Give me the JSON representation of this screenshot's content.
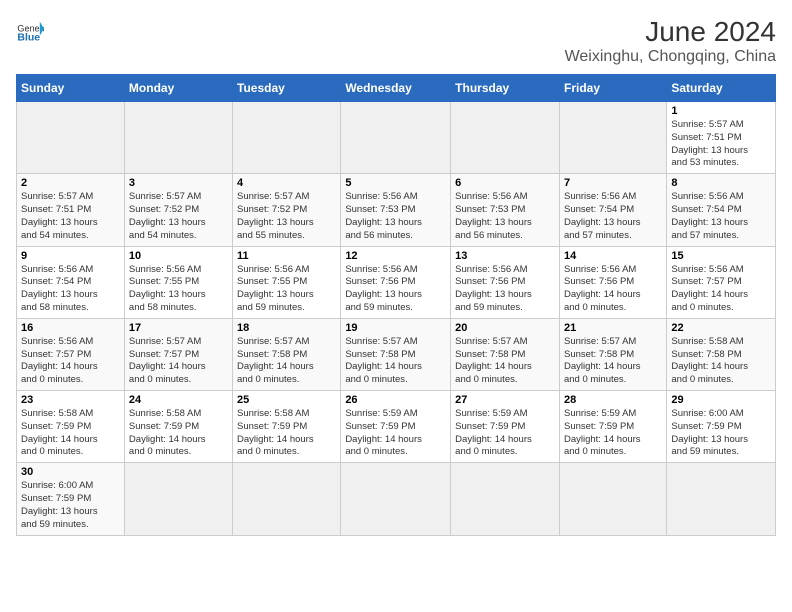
{
  "header": {
    "logo_general": "General",
    "logo_blue": "Blue",
    "main_title": "June 2024",
    "subtitle": "Weixinghu, Chongqing, China"
  },
  "columns": [
    "Sunday",
    "Monday",
    "Tuesday",
    "Wednesday",
    "Thursday",
    "Friday",
    "Saturday"
  ],
  "weeks": [
    [
      {
        "day": "",
        "info": ""
      },
      {
        "day": "",
        "info": ""
      },
      {
        "day": "",
        "info": ""
      },
      {
        "day": "",
        "info": ""
      },
      {
        "day": "",
        "info": ""
      },
      {
        "day": "",
        "info": ""
      },
      {
        "day": "1",
        "info": "Sunrise: 5:57 AM\nSunset: 7:51 PM\nDaylight: 13 hours\nand 53 minutes."
      }
    ],
    [
      {
        "day": "2",
        "info": "Sunrise: 5:57 AM\nSunset: 7:51 PM\nDaylight: 13 hours\nand 54 minutes."
      },
      {
        "day": "3",
        "info": "Sunrise: 5:57 AM\nSunset: 7:52 PM\nDaylight: 13 hours\nand 54 minutes."
      },
      {
        "day": "4",
        "info": "Sunrise: 5:57 AM\nSunset: 7:52 PM\nDaylight: 13 hours\nand 55 minutes."
      },
      {
        "day": "5",
        "info": "Sunrise: 5:56 AM\nSunset: 7:53 PM\nDaylight: 13 hours\nand 56 minutes."
      },
      {
        "day": "6",
        "info": "Sunrise: 5:56 AM\nSunset: 7:53 PM\nDaylight: 13 hours\nand 56 minutes."
      },
      {
        "day": "7",
        "info": "Sunrise: 5:56 AM\nSunset: 7:54 PM\nDaylight: 13 hours\nand 57 minutes."
      },
      {
        "day": "8",
        "info": "Sunrise: 5:56 AM\nSunset: 7:54 PM\nDaylight: 13 hours\nand 57 minutes."
      }
    ],
    [
      {
        "day": "9",
        "info": "Sunrise: 5:56 AM\nSunset: 7:54 PM\nDaylight: 13 hours\nand 58 minutes."
      },
      {
        "day": "10",
        "info": "Sunrise: 5:56 AM\nSunset: 7:55 PM\nDaylight: 13 hours\nand 58 minutes."
      },
      {
        "day": "11",
        "info": "Sunrise: 5:56 AM\nSunset: 7:55 PM\nDaylight: 13 hours\nand 59 minutes."
      },
      {
        "day": "12",
        "info": "Sunrise: 5:56 AM\nSunset: 7:56 PM\nDaylight: 13 hours\nand 59 minutes."
      },
      {
        "day": "13",
        "info": "Sunrise: 5:56 AM\nSunset: 7:56 PM\nDaylight: 13 hours\nand 59 minutes."
      },
      {
        "day": "14",
        "info": "Sunrise: 5:56 AM\nSunset: 7:56 PM\nDaylight: 14 hours\nand 0 minutes."
      },
      {
        "day": "15",
        "info": "Sunrise: 5:56 AM\nSunset: 7:57 PM\nDaylight: 14 hours\nand 0 minutes."
      }
    ],
    [
      {
        "day": "16",
        "info": "Sunrise: 5:56 AM\nSunset: 7:57 PM\nDaylight: 14 hours\nand 0 minutes."
      },
      {
        "day": "17",
        "info": "Sunrise: 5:57 AM\nSunset: 7:57 PM\nDaylight: 14 hours\nand 0 minutes."
      },
      {
        "day": "18",
        "info": "Sunrise: 5:57 AM\nSunset: 7:58 PM\nDaylight: 14 hours\nand 0 minutes."
      },
      {
        "day": "19",
        "info": "Sunrise: 5:57 AM\nSunset: 7:58 PM\nDaylight: 14 hours\nand 0 minutes."
      },
      {
        "day": "20",
        "info": "Sunrise: 5:57 AM\nSunset: 7:58 PM\nDaylight: 14 hours\nand 0 minutes."
      },
      {
        "day": "21",
        "info": "Sunrise: 5:57 AM\nSunset: 7:58 PM\nDaylight: 14 hours\nand 0 minutes."
      },
      {
        "day": "22",
        "info": "Sunrise: 5:58 AM\nSunset: 7:58 PM\nDaylight: 14 hours\nand 0 minutes."
      }
    ],
    [
      {
        "day": "23",
        "info": "Sunrise: 5:58 AM\nSunset: 7:59 PM\nDaylight: 14 hours\nand 0 minutes."
      },
      {
        "day": "24",
        "info": "Sunrise: 5:58 AM\nSunset: 7:59 PM\nDaylight: 14 hours\nand 0 minutes."
      },
      {
        "day": "25",
        "info": "Sunrise: 5:58 AM\nSunset: 7:59 PM\nDaylight: 14 hours\nand 0 minutes."
      },
      {
        "day": "26",
        "info": "Sunrise: 5:59 AM\nSunset: 7:59 PM\nDaylight: 14 hours\nand 0 minutes."
      },
      {
        "day": "27",
        "info": "Sunrise: 5:59 AM\nSunset: 7:59 PM\nDaylight: 14 hours\nand 0 minutes."
      },
      {
        "day": "28",
        "info": "Sunrise: 5:59 AM\nSunset: 7:59 PM\nDaylight: 14 hours\nand 0 minutes."
      },
      {
        "day": "29",
        "info": "Sunrise: 6:00 AM\nSunset: 7:59 PM\nDaylight: 13 hours\nand 59 minutes."
      }
    ],
    [
      {
        "day": "30",
        "info": "Sunrise: 6:00 AM\nSunset: 7:59 PM\nDaylight: 13 hours\nand 59 minutes."
      },
      {
        "day": "",
        "info": ""
      },
      {
        "day": "",
        "info": ""
      },
      {
        "day": "",
        "info": ""
      },
      {
        "day": "",
        "info": ""
      },
      {
        "day": "",
        "info": ""
      },
      {
        "day": "",
        "info": ""
      }
    ]
  ]
}
